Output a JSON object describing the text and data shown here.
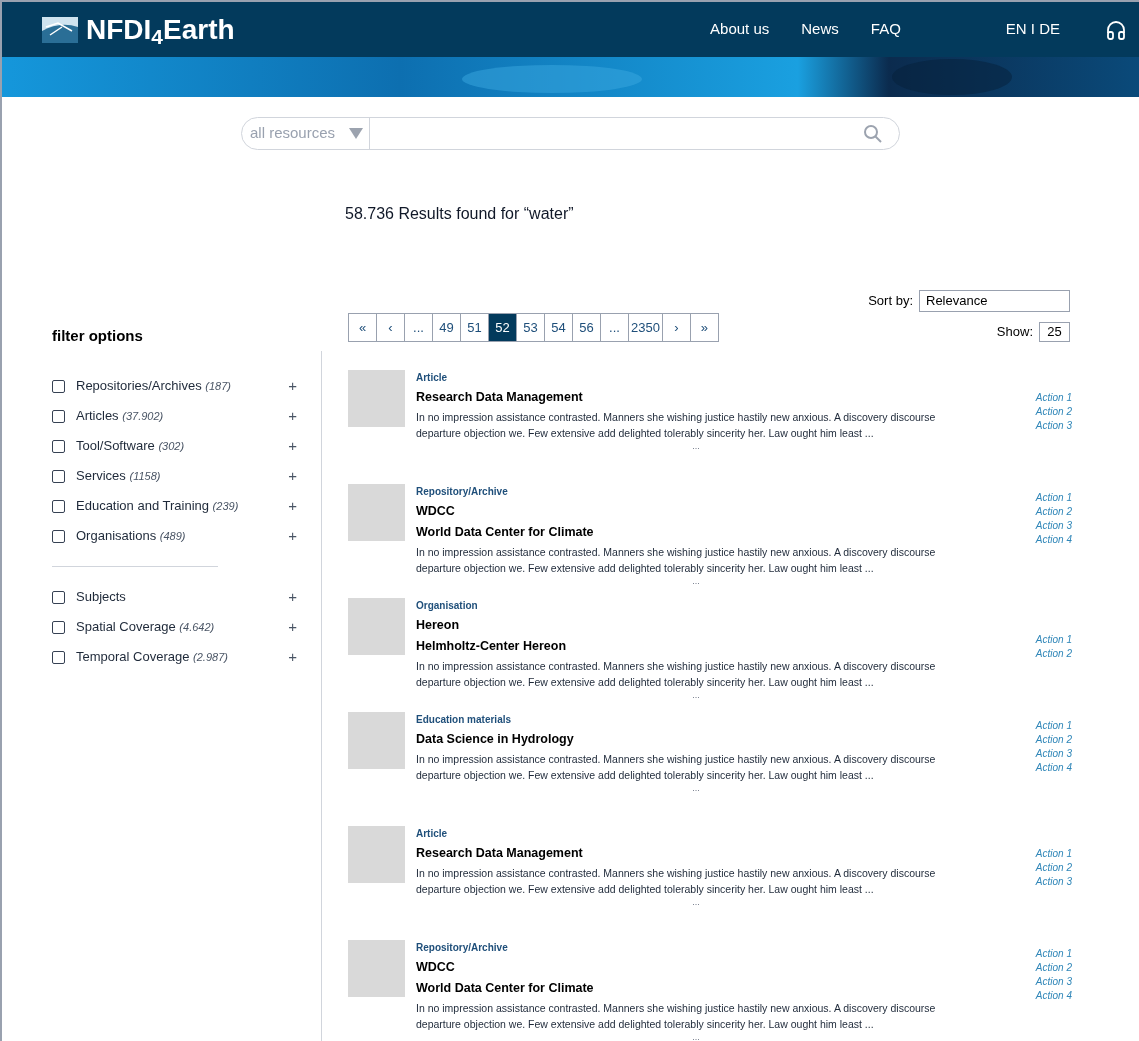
{
  "header": {
    "logo": "NFDI$_{4}$Earth",
    "nav": [
      "About us",
      "News",
      "FAQ"
    ],
    "language": "EN I DE"
  },
  "search": {
    "scope": "all resources"
  },
  "results_heading": "58.736 Results found for “water”",
  "filter": {
    "title": "filter options",
    "groups": [
      [
        {
          "label": "Repositories/Archives",
          "count": "(187)",
          "checked": false
        },
        {
          "label": "Articles",
          "count": "(37.902)",
          "checked": false
        },
        {
          "label": "Tool/Software",
          "count": "(302)",
          "checked": false
        },
        {
          "label": "Services",
          "count": "(1158)",
          "checked": false
        },
        {
          "label": "Education and Training",
          "count": "(239)",
          "checked": false
        },
        {
          "label": "Organisations",
          "count": "(489)",
          "checked": false
        }
      ],
      [
        {
          "label": "Subjects",
          "checked": false
        },
        {
          "label": "Spatial Coverage",
          "count": "(4.642)",
          "checked": false
        },
        {
          "label": "Temporal Coverage",
          "count": "(2.987)",
          "checked": false
        }
      ]
    ],
    "expand": "+"
  },
  "sort": {
    "label": "Sort by:",
    "value": "Relevance"
  },
  "show": {
    "label": "Show:",
    "value": "25"
  },
  "pagination": [
    {
      "label": "«",
      "selected": false
    },
    {
      "label": "‹",
      "selected": false
    },
    {
      "label": "...",
      "selected": false
    },
    {
      "label": "49",
      "selected": false
    },
    {
      "label": "51",
      "selected": false
    },
    {
      "label": "52",
      "selected": true
    },
    {
      "label": "53",
      "selected": false
    },
    {
      "label": "54",
      "selected": false
    },
    {
      "label": "56",
      "selected": false
    },
    {
      "label": "...",
      "selected": false
    },
    {
      "label": "2350",
      "selected": false
    },
    {
      "label": "›",
      "selected": false
    },
    {
      "label": "»",
      "selected": false
    }
  ],
  "results": [
    {
      "type": "Article",
      "title": "Research Data  Management",
      "text": "In no impression assistance contrasted. Manners she wishing justice hastily new anxious. A discovery discourse departure objection we. Few extensive add delighted tolerably sincerity her. Law ought him least ...",
      "more": "...",
      "actions": [
        "Action 1",
        "Action 2",
        "Action 3"
      ]
    },
    {
      "type": "Repository/Archive",
      "title": "WDCC",
      "subtitle": "World Data Center for Climate",
      "text": "In no impression assistance contrasted. Manners she wishing justice hastily new anxious. A discovery discourse departure objection we. Few extensive add delighted tolerably sincerity her. Law ought him least ...",
      "more": "...",
      "actions": [
        "Action 1",
        "Action 2",
        "Action 3",
        "Action 4"
      ]
    },
    {
      "type": "Organisation",
      "title": "Hereon",
      "subtitle": "Helmholtz-Center Hereon",
      "text": "In no impression assistance contrasted. Manners she wishing justice hastily new anxious. A discovery discourse departure objection we. Few extensive add delighted tolerably sincerity her. Law ought him least ...",
      "more": "...",
      "actions": [
        "Action 1",
        "Action 2"
      ]
    },
    {
      "type": "Education materials",
      "title": "Data Science in Hydrology",
      "text": "In no impression assistance contrasted. Manners she wishing justice hastily new anxious. A discovery discourse departure objection we. Few extensive add delighted tolerably sincerity her. Law ought him least ...",
      "more": "...",
      "actions": [
        "Action 1",
        "Action 2",
        "Action 3",
        "Action 4"
      ]
    },
    {
      "type": "Article",
      "title": "Research Data  Management",
      "text": "In no impression assistance contrasted. Manners she wishing justice hastily new anxious. A discovery discourse departure objection we. Few extensive add delighted tolerably sincerity her. Law ought him least ...",
      "more": "...",
      "actions": [
        "Action 1",
        "Action 2",
        "Action 3"
      ]
    },
    {
      "type": "Repository/Archive",
      "title": "WDCC",
      "subtitle": "World Data Center for Climate",
      "text": "In no impression assistance contrasted. Manners she wishing justice hastily new anxious. A discovery discourse departure objection we. Few extensive add delighted tolerably sincerity her. Law ought him least ...",
      "more": "...",
      "actions": [
        "Action 1",
        "Action 2",
        "Action 3",
        "Action 4"
      ]
    }
  ]
}
